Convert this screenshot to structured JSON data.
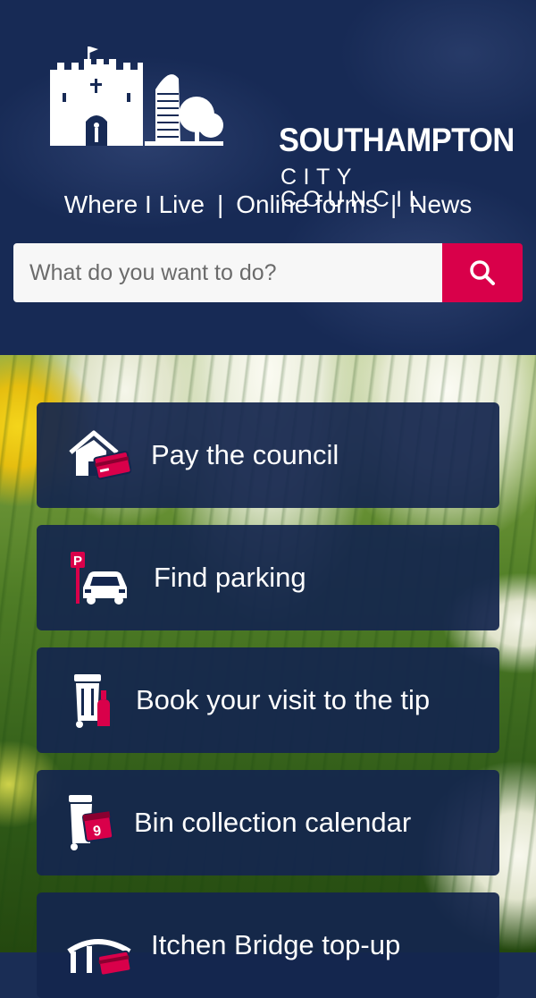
{
  "header": {
    "logo": {
      "line1": "SOUTHAMPTON",
      "line2": "CITY COUNCIL",
      "icon": "castle-and-tower-logo"
    },
    "nav": {
      "where_i_live": "Where I Live",
      "separator": "|",
      "online_forms": "Online forms",
      "news": "News"
    },
    "search": {
      "placeholder": "What do you want to do?",
      "value": "",
      "button_icon": "search-icon"
    }
  },
  "tasks": [
    {
      "label": "Pay the council",
      "icon": "house-with-card-icon"
    },
    {
      "label": "Find parking",
      "icon": "parking-car-icon"
    },
    {
      "label": "Book your visit to the tip",
      "icon": "bin-and-bottle-icon"
    },
    {
      "label": "Bin collection calendar",
      "icon": "bin-calendar-icon"
    },
    {
      "label": "Itchen Bridge top-up",
      "icon": "bridge-card-icon"
    }
  ],
  "colors": {
    "navy": "#172a55",
    "card": "#14264e",
    "accent": "#d9004a",
    "white": "#ffffff"
  }
}
